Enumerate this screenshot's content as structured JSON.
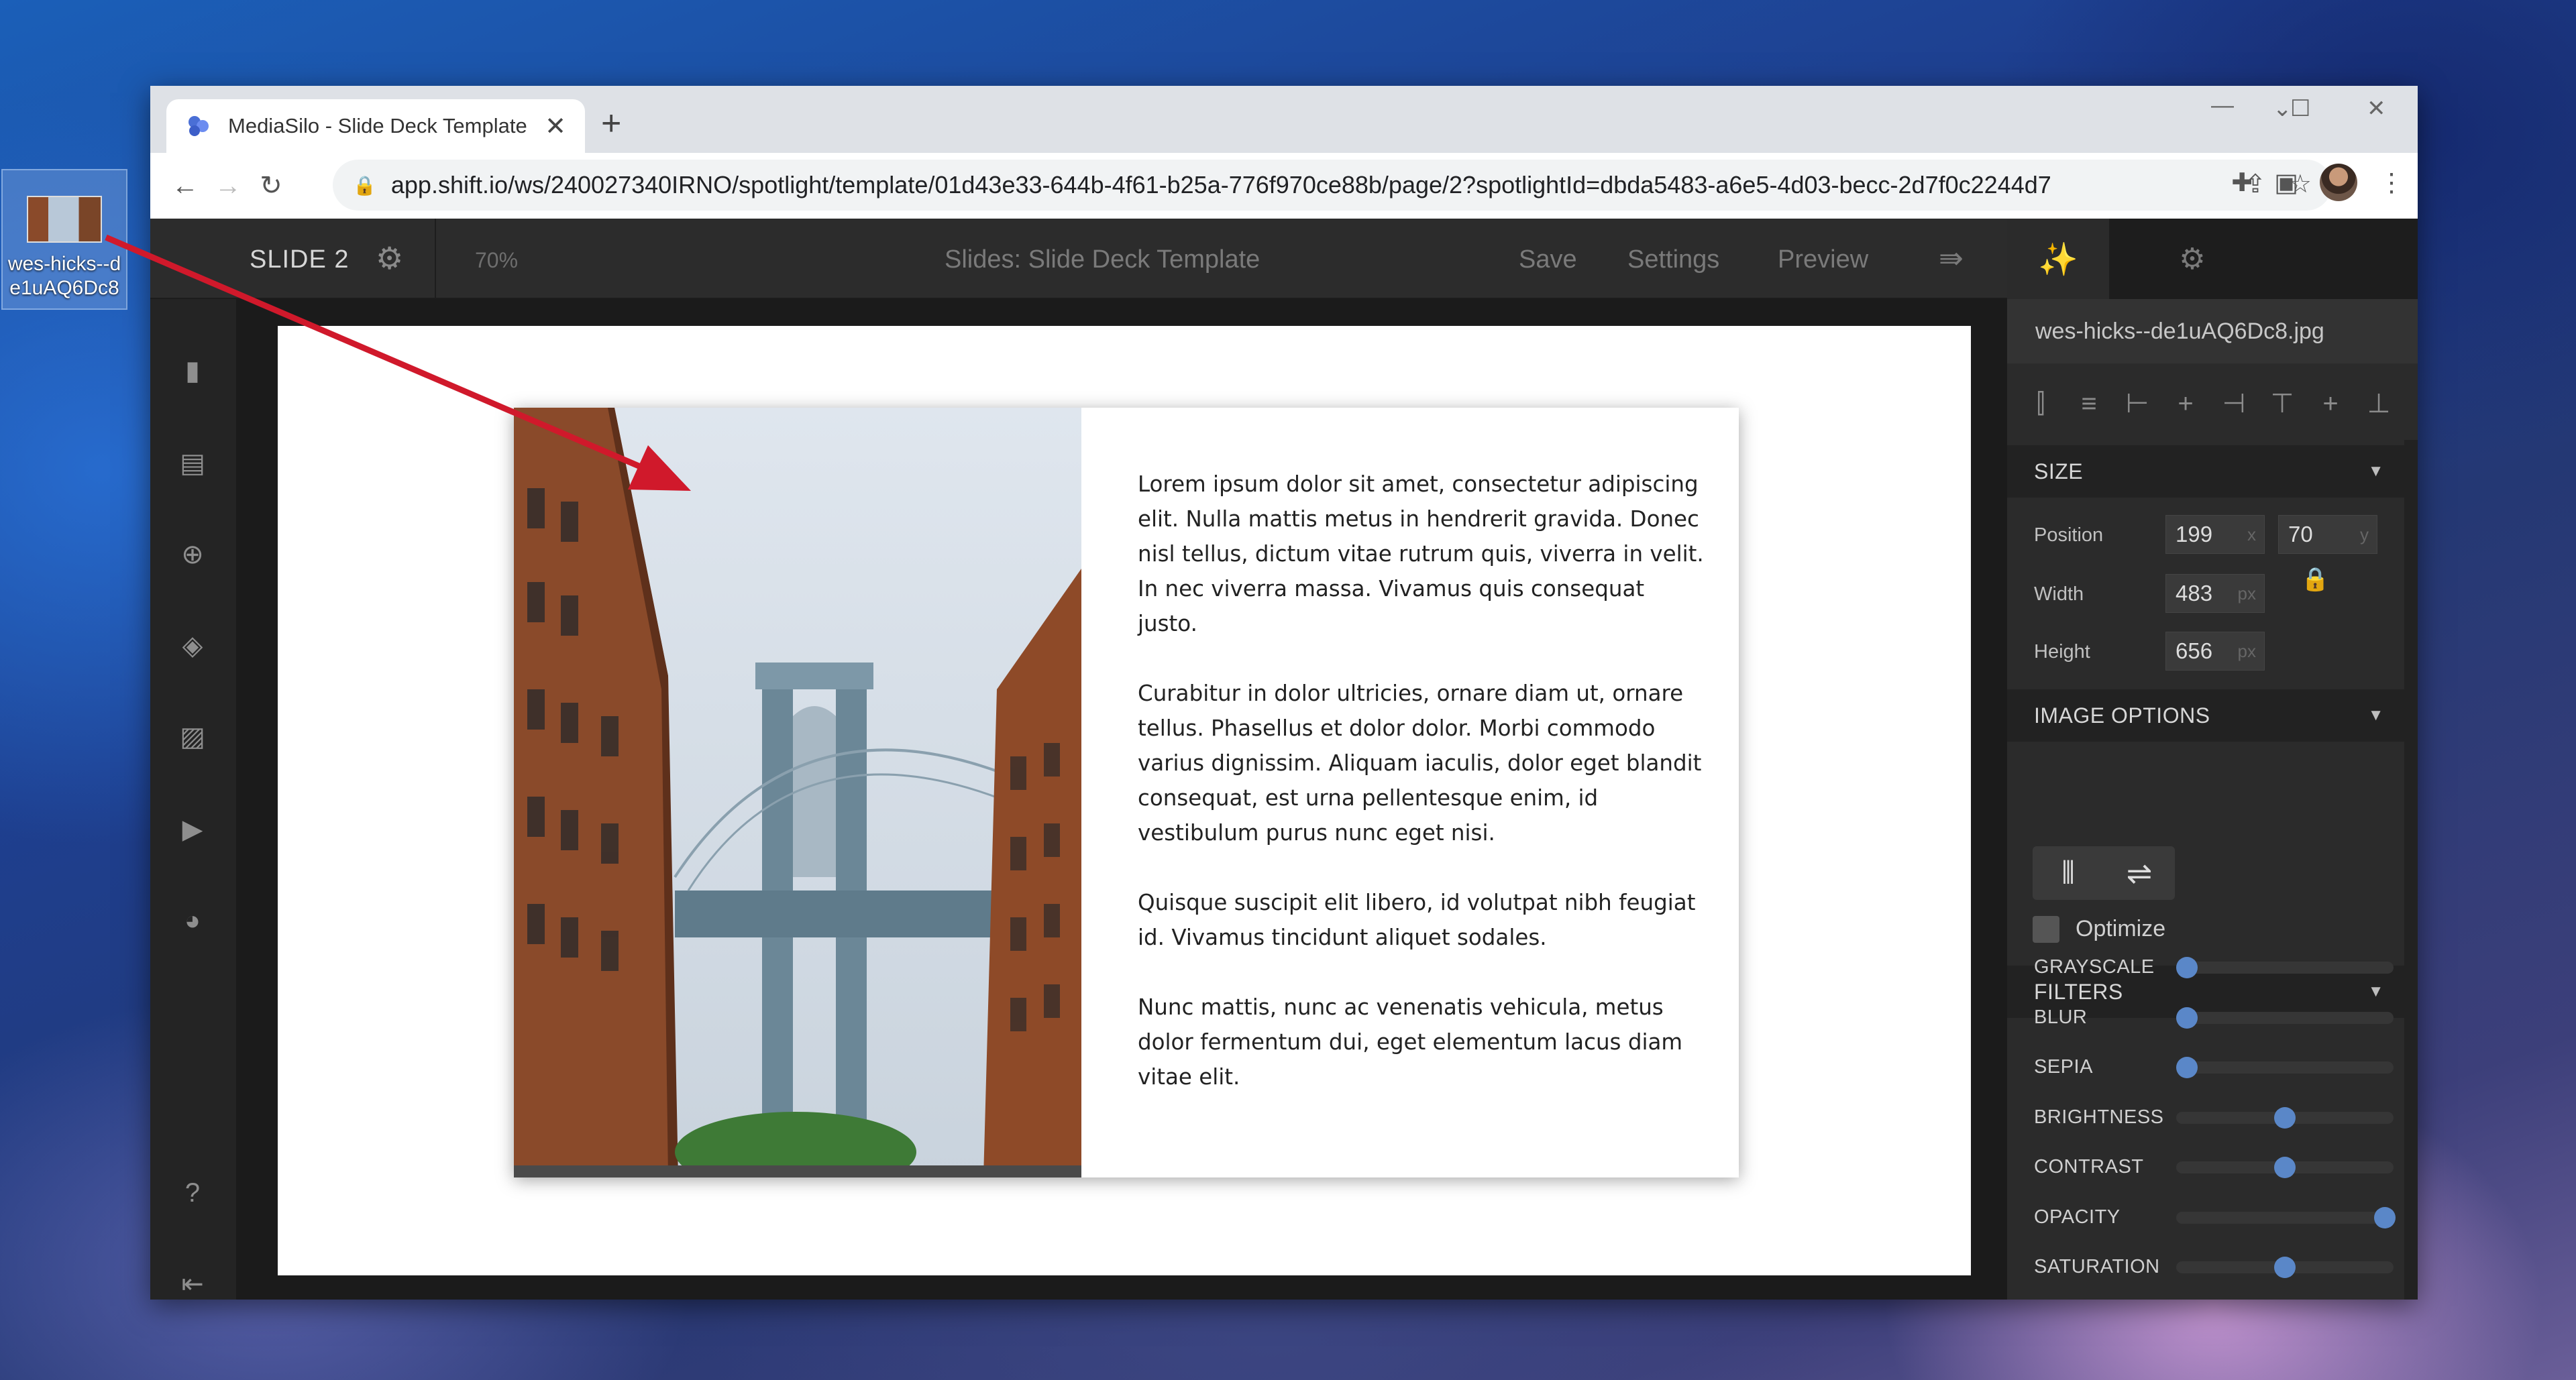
{
  "desktop": {
    "icon_label": "wes-hicks--de1uAQ6Dc8"
  },
  "browser": {
    "tab_title": "MediaSilo - Slide Deck Template",
    "tab_close": "✕",
    "new_tab": "+",
    "url": "app.shift.io/ws/240027340IRNO/spotlight/template/01d43e33-644b-4f61-b25a-776f970ce88b/page/2?spotlightId=dbda5483-a6e5-4d03-becc-2d7f0c2244d7",
    "window_controls": [
      "⌄",
      "—",
      "☐",
      "✕"
    ]
  },
  "app": {
    "slide_label": "SLIDE 2",
    "zoom": "70%",
    "doc_title": "Slides: Slide Deck Template",
    "buttons": {
      "save": "Save",
      "settings": "Settings",
      "preview": "Preview"
    },
    "slide_text": [
      "Lorem ipsum dolor sit amet, consectetur adipiscing elit. Nulla mattis metus in hendrerit gravida. Donec nisl tellus, dictum vitae rutrum quis, viverra in velit. In nec viverra massa. Vivamus quis consequat justo.",
      "Curabitur in dolor ultricies, ornare diam ut, ornare tellus. Phasellus et dolor dolor. Morbi commodo varius dignissim. Aliquam iaculis, dolor eget blandit consequat, est urna pellentesque enim, id vestibulum purus nunc eget nisi.",
      "Quisque suscipit elit libero, id volutpat nibh feugiat id. Vivamus tincidunt aliquet sodales.",
      "Nunc mattis, nunc ac venenatis vehicula, metus dolor fermentum dui, eget elementum lacus diam vitae elit."
    ]
  },
  "panel": {
    "filename": "wes-hicks--de1uAQ6Dc8.jpg",
    "size_section": "SIZE",
    "position_label": "Position",
    "position_x": "199",
    "position_x_unit": "x",
    "position_y": "70",
    "position_y_unit": "y",
    "width_label": "Width",
    "width": "483",
    "height_label": "Height",
    "height": "656",
    "px_unit": "px",
    "image_options_section": "IMAGE OPTIONS",
    "optimize_label": "Optimize",
    "filters_section": "FILTERS",
    "filters": [
      {
        "name": "GRAYSCALE",
        "level": 0.05
      },
      {
        "name": "BLUR",
        "level": 0.05
      },
      {
        "name": "SEPIA",
        "level": 0.05
      },
      {
        "name": "BRIGHTNESS",
        "level": 0.5
      },
      {
        "name": "CONTRAST",
        "level": 0.5
      },
      {
        "name": "OPACITY",
        "level": 0.96
      },
      {
        "name": "SATURATION",
        "level": 0.5
      }
    ]
  },
  "colors": {
    "accent": "#5a87c8",
    "arrow": "#d0192b"
  }
}
